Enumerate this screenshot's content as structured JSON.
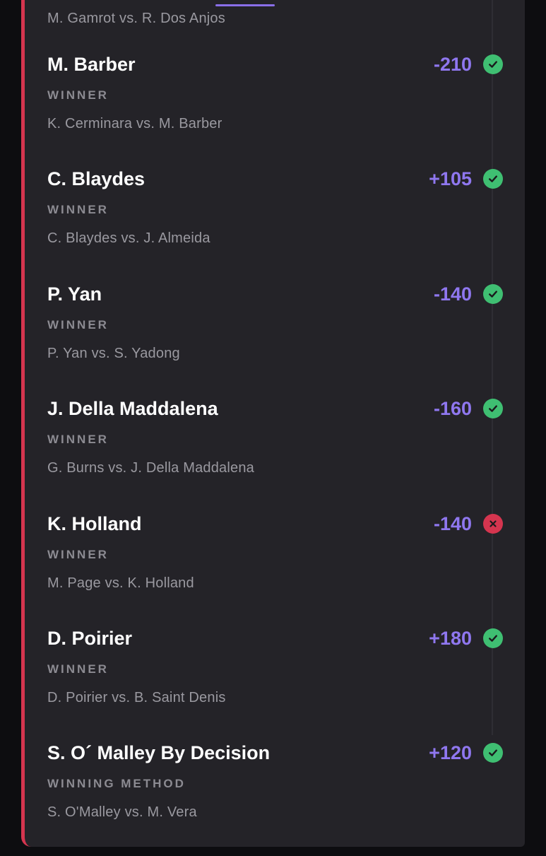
{
  "previous_matchup": "M. Gamrot vs. R. Dos Anjos",
  "colors": {
    "accent": "#8f77ef",
    "won": "#3fbf72",
    "lost": "#d5354f",
    "card_background": "#242328"
  },
  "legs": [
    {
      "pick": "M. Barber",
      "odds": "-210",
      "market": "WINNER",
      "matchup": "K. Cerminara vs. M. Barber",
      "status": "won",
      "status_icon": "check-icon"
    },
    {
      "pick": "C. Blaydes",
      "odds": "+105",
      "market": "WINNER",
      "matchup": "C. Blaydes vs. J. Almeida",
      "status": "won",
      "status_icon": "check-icon"
    },
    {
      "pick": "P. Yan",
      "odds": "-140",
      "market": "WINNER",
      "matchup": "P. Yan vs. S. Yadong",
      "status": "won",
      "status_icon": "check-icon"
    },
    {
      "pick": "J. Della Maddalena",
      "odds": "-160",
      "market": "WINNER",
      "matchup": "G. Burns vs. J. Della Maddalena",
      "status": "won",
      "status_icon": "check-icon"
    },
    {
      "pick": "K. Holland",
      "odds": "-140",
      "market": "WINNER",
      "matchup": "M. Page vs. K. Holland",
      "status": "lost",
      "status_icon": "x-icon"
    },
    {
      "pick": "D. Poirier",
      "odds": "+180",
      "market": "WINNER",
      "matchup": "D. Poirier vs. B. Saint Denis",
      "status": "won",
      "status_icon": "check-icon"
    },
    {
      "pick": "S. O´ Malley By Decision",
      "odds": "+120",
      "market": "WINNING METHOD",
      "matchup": "S. O'Malley vs. M. Vera",
      "status": "won",
      "status_icon": "check-icon"
    }
  ]
}
